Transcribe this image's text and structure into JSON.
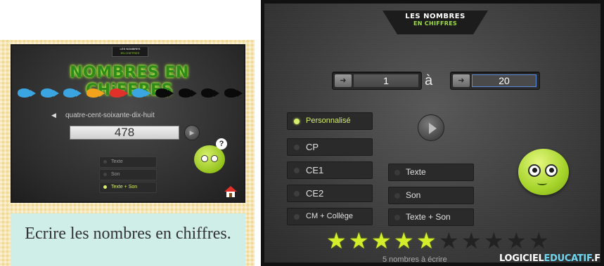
{
  "thumbnail": {
    "logo_line1": "LES NOMBRES",
    "logo_line2": "EN CHIFFRES",
    "title": "NOMBRES EN CHiFFRES",
    "fish_colors": [
      "blue",
      "blue",
      "blue",
      "orange",
      "red",
      "blue",
      "black",
      "black",
      "black",
      "black"
    ],
    "spoken_words": "quatre-cent-soixante-dix-huit",
    "answer_value": "478",
    "bubble_char": "?",
    "modes": [
      {
        "label": "Texte",
        "selected": false
      },
      {
        "label": "Son",
        "selected": false
      },
      {
        "label": "Texte + Son",
        "selected": true
      }
    ],
    "caption": "Ecrire les nombres en chiffres."
  },
  "app": {
    "logo_line1": "LES NOMBRES",
    "logo_line2": "EN CHIFFRES",
    "range": {
      "from_value": "1",
      "separator": "à",
      "to_value": "20"
    },
    "levels": [
      {
        "label": "Personnalisé",
        "selected": true
      },
      {
        "label": "CP",
        "selected": false
      },
      {
        "label": "CE1",
        "selected": false
      },
      {
        "label": "CE2",
        "selected": false
      },
      {
        "label": "CM + Collège",
        "selected": false
      }
    ],
    "modes": [
      {
        "label": "Texte",
        "selected": false
      },
      {
        "label": "Son",
        "selected": false
      },
      {
        "label": "Texte + Son",
        "selected": false
      }
    ],
    "rating": {
      "filled": 5,
      "total": 10
    },
    "rating_caption": "5 nombres à écrire",
    "brand": {
      "part1": "LOGICIEL",
      "part2": "EDUCATIF",
      "part3": ".FR"
    },
    "colors": {
      "accent": "#d6f06a",
      "star": "#d4ee2c",
      "brand_blue": "#6fd6f0"
    }
  }
}
